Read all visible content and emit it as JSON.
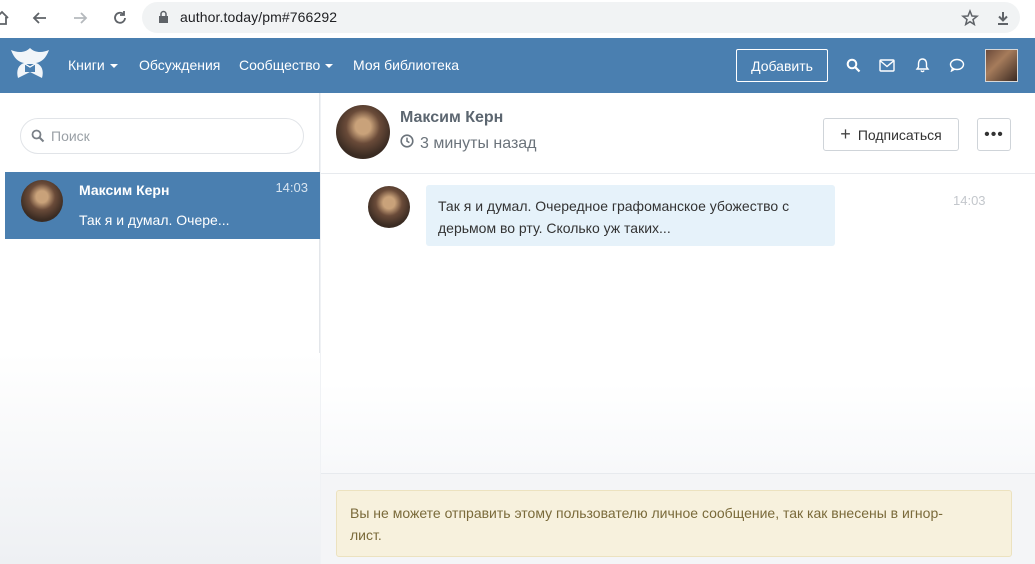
{
  "browser": {
    "url": "author.today/pm#766292"
  },
  "header": {
    "menu": [
      {
        "label": "Книги",
        "has_caret": true
      },
      {
        "label": "Обсуждения",
        "has_caret": false
      },
      {
        "label": "Сообщество",
        "has_caret": true
      },
      {
        "label": "Моя библиотека",
        "has_caret": false
      }
    ],
    "add_label": "Добавить",
    "colors": {
      "bar": "#4a7fb0"
    }
  },
  "sidebar": {
    "search_placeholder": "Поиск",
    "conversations": [
      {
        "name": "Максим Керн",
        "time": "14:03",
        "snippet": "Так я и думал. Очере..."
      }
    ]
  },
  "chat": {
    "name": "Максим Керн",
    "status": "3 минуты назад",
    "subscribe_label": "Подписаться",
    "more_label": "•••",
    "messages": [
      {
        "text_line1": "Так я и думал. Очередное графоманское убожество с",
        "text_line2": "дерьмом во рту. Сколько уж таких...",
        "time": "14:03"
      }
    ],
    "warning_line1": "Вы не можете отправить этому пользователю личное сообщение, так как внесены в игнор-",
    "warning_line2": "лист."
  }
}
